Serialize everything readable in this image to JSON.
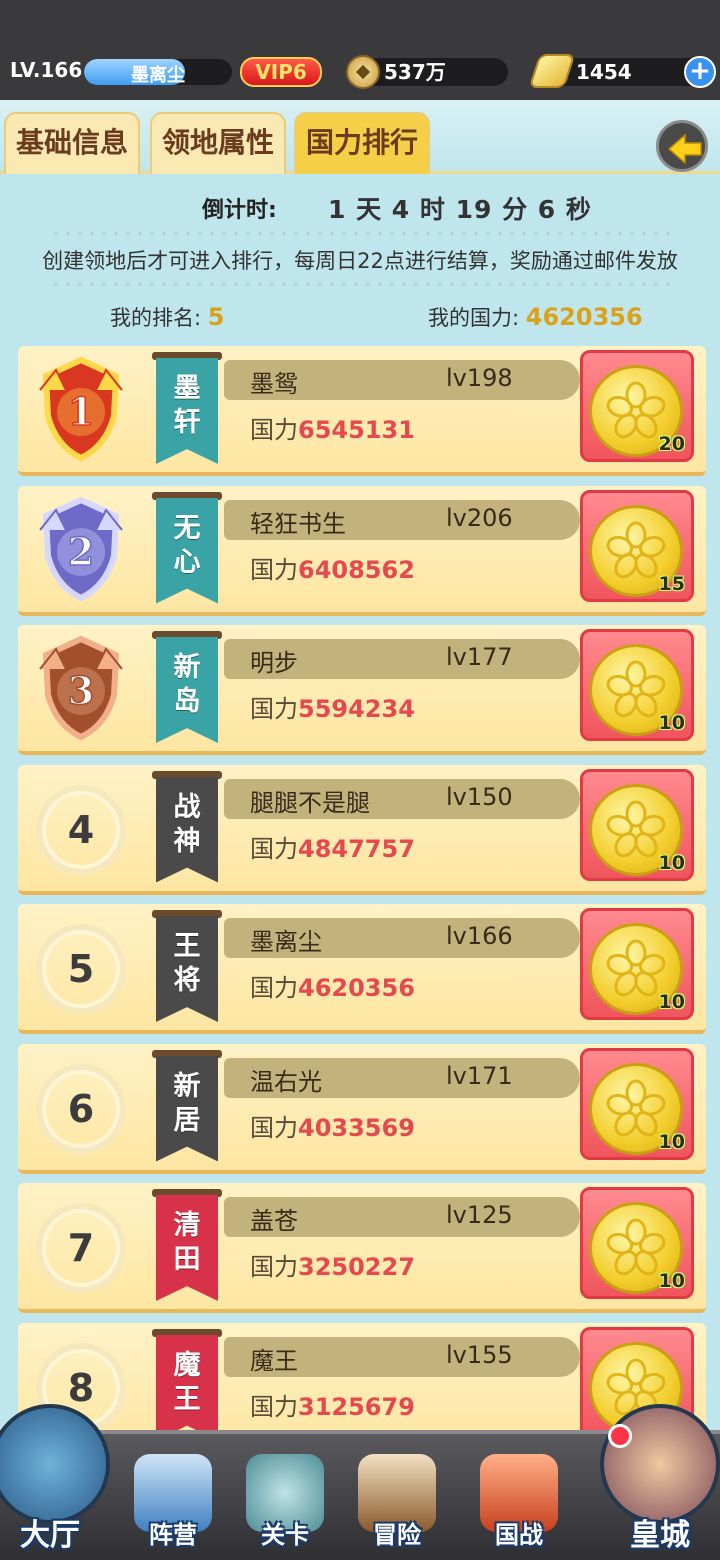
{
  "header": {
    "level": "LV.166",
    "player_name": "墨离尘",
    "vip": "VIP6",
    "copper_coins": "537万",
    "gold": "1454",
    "plus": "+"
  },
  "tabs": [
    {
      "label": "基础信息",
      "active": false
    },
    {
      "label": "领地属性",
      "active": false
    },
    {
      "label": "国力排行",
      "active": true
    }
  ],
  "countdown": {
    "label": "倒计时:",
    "value": "1 天 4 时 19 分 6 秒"
  },
  "notice": "创建领地后才可进入排行，每周日22点进行结算，奖励通过邮件发放",
  "my_rank": {
    "label": "我的排名:",
    "value": "5"
  },
  "my_power": {
    "label": "我的国力:",
    "value": "4620356"
  },
  "power_label": "国力",
  "rankings": [
    {
      "rank": "1",
      "banner": "墨轩",
      "banner_color": "#3aa3a6",
      "name": "墨鸳",
      "level": "lv198",
      "power": "6545131",
      "reward": "20"
    },
    {
      "rank": "2",
      "banner": "无心",
      "banner_color": "#3aa3a6",
      "name": "轻狂书生",
      "level": "lv206",
      "power": "6408562",
      "reward": "15"
    },
    {
      "rank": "3",
      "banner": "新岛",
      "banner_color": "#3aa3a6",
      "name": "明步",
      "level": "lv177",
      "power": "5594234",
      "reward": "10"
    },
    {
      "rank": "4",
      "banner": "战神",
      "banner_color": "#4a4a4a",
      "name": "腿腿不是腿",
      "level": "lv150",
      "power": "4847757",
      "reward": "10"
    },
    {
      "rank": "5",
      "banner": "王将",
      "banner_color": "#4a4a4a",
      "name": "墨离尘",
      "level": "lv166",
      "power": "4620356",
      "reward": "10"
    },
    {
      "rank": "6",
      "banner": "新居",
      "banner_color": "#4a4a4a",
      "name": "温右光",
      "level": "lv171",
      "power": "4033569",
      "reward": "10"
    },
    {
      "rank": "7",
      "banner": "清田",
      "banner_color": "#d8324a",
      "name": "盖苍",
      "level": "lv125",
      "power": "3250227",
      "reward": "10"
    },
    {
      "rank": "8",
      "banner": "魔王",
      "banner_color": "#d8324a",
      "name": "魔王",
      "level": "lv155",
      "power": "3125679",
      "reward": ""
    }
  ],
  "bottom_nav": [
    {
      "label": "大厅",
      "icon": "castle-icon"
    },
    {
      "label": "阵营",
      "icon": "map-scroll-icon"
    },
    {
      "label": "关卡",
      "icon": "crossed-swords-icon"
    },
    {
      "label": "冒险",
      "icon": "ship-icon"
    },
    {
      "label": "国战",
      "icon": "war-flags-icon"
    },
    {
      "label": "皇城",
      "icon": "palace-icon"
    }
  ],
  "colors": {
    "accent_gold": "#d9a21a",
    "power_red": "#e4494f",
    "tab_active": "#f6cf48"
  }
}
